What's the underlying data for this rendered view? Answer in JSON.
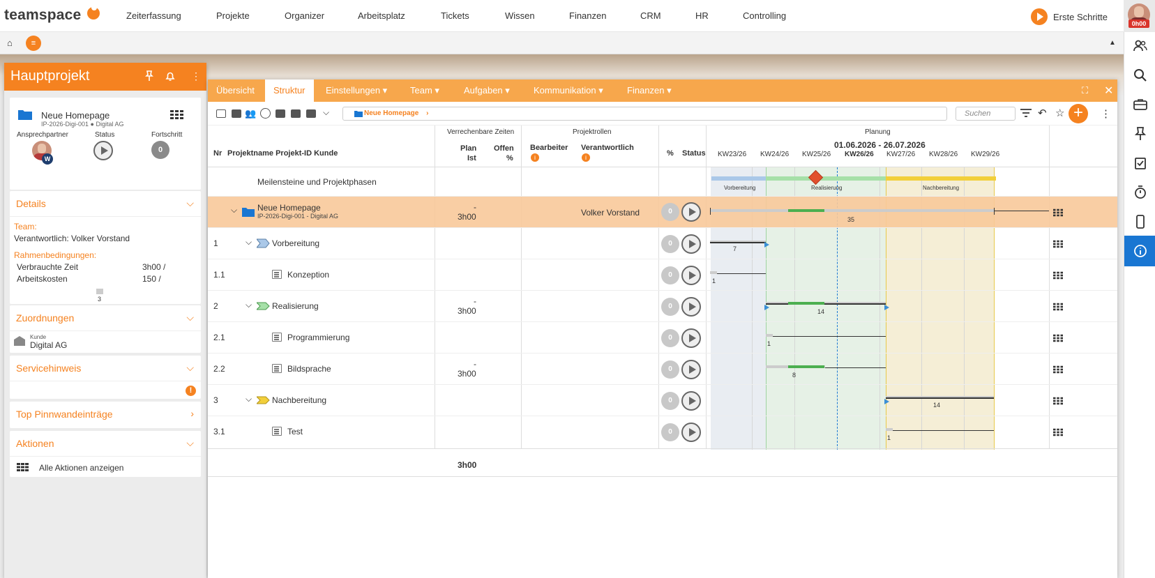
{
  "topnav": {
    "logo": "teamspace",
    "items": [
      "Zeiterfassung",
      "Projekte",
      "Organizer",
      "Arbeitsplatz",
      "Tickets",
      "Wissen",
      "Finanzen",
      "CRM",
      "HR",
      "Controlling"
    ],
    "cta": "Erste Schritte",
    "timer": "0h00"
  },
  "left": {
    "title": "Hauptprojekt",
    "project_name": "Neue Homepage",
    "project_sub": "IP-2026-Digi-001 ● Digital AG",
    "labels": {
      "contact": "Ansprechpartner",
      "status": "Status",
      "progress": "Fortschritt"
    },
    "progress_value": "0",
    "details": {
      "title": "Details",
      "team_label": "Team:",
      "responsible": "Verantwortlich: Volker Vorstand",
      "rahmen_label": "Rahmenbedingungen:",
      "rows": [
        {
          "label": "Verbrauchte Zeit",
          "value": "3h00 /"
        },
        {
          "label": "Arbeitskosten",
          "value": "150 /"
        }
      ],
      "flag_count": "3"
    },
    "zuordnungen": {
      "title": "Zuordnungen",
      "kunde_label": "Kunde",
      "kunde_value": "Digital AG"
    },
    "service": {
      "title": "Servicehinweis"
    },
    "pinnwand": {
      "title": "Top Pinnwandeinträge"
    },
    "aktionen": {
      "title": "Aktionen",
      "all": "Alle Aktionen anzeigen"
    }
  },
  "tabs": [
    {
      "label": "Übersicht"
    },
    {
      "label": "Struktur"
    },
    {
      "label": "Einstellungen ▾"
    },
    {
      "label": "Team ▾"
    },
    {
      "label": "Aufgaben ▾"
    },
    {
      "label": "Kommunikation ▾"
    },
    {
      "label": "Finanzen ▾"
    }
  ],
  "toolbar": {
    "breadcrumb": "Neue Homepage",
    "search_placeholder": "Suchen"
  },
  "header": {
    "nr": "Nr",
    "projektname": "Projektname Projekt-ID Kunde",
    "vz": "Verrechenbare Zeiten",
    "plan": "Plan",
    "ist": "Ist",
    "offen": "Offen",
    "pct": "%",
    "rollen": "Projektrollen",
    "bearbeiter": "Bearbeiter",
    "verantwortlich": "Verantwortlich",
    "percent": "%",
    "status": "Status",
    "planung": "Planung",
    "range": "01.06.2026 - 26.07.2026",
    "weeks": [
      "KW23/26",
      "KW24/26",
      "KW25/26",
      "KW26/26",
      "KW27/26",
      "KW28/26",
      "KW29/26"
    ]
  },
  "milestones": {
    "label": "Meilensteine und Projektphasen",
    "phases": [
      "Vorbereitung",
      "Realisierung",
      "Nachbereitung"
    ]
  },
  "rows": [
    {
      "nr": "",
      "name": "Neue Homepage",
      "sub": "IP-2026-Digi-001 - Digital AG",
      "plan": "-",
      "ist": "3h00",
      "resp": "Volker Vorstand",
      "pct": "0",
      "bar_label": "35"
    },
    {
      "nr": "1",
      "name": "Vorbereitung",
      "plan": "",
      "ist": "",
      "pct": "0",
      "bar_label": "7"
    },
    {
      "nr": "1.1",
      "name": "Konzeption",
      "plan": "",
      "ist": "",
      "pct": "0",
      "bar_label": "1"
    },
    {
      "nr": "2",
      "name": "Realisierung",
      "plan": "-",
      "ist": "3h00",
      "pct": "0",
      "bar_label": "14"
    },
    {
      "nr": "2.1",
      "name": "Programmierung",
      "plan": "",
      "ist": "",
      "pct": "0",
      "bar_label": "1"
    },
    {
      "nr": "2.2",
      "name": "Bildsprache",
      "plan": "-",
      "ist": "3h00",
      "pct": "0",
      "bar_label": "8"
    },
    {
      "nr": "3",
      "name": "Nachbereitung",
      "plan": "",
      "ist": "",
      "pct": "0",
      "bar_label": "14"
    },
    {
      "nr": "3.1",
      "name": "Test",
      "plan": "",
      "ist": "",
      "pct": "0",
      "bar_label": "1"
    }
  ],
  "total": "3h00",
  "colors": {
    "accent": "#f58220",
    "tabbar": "#f7a74c",
    "active_row": "#f8c99a",
    "blue": "#1976d2"
  }
}
